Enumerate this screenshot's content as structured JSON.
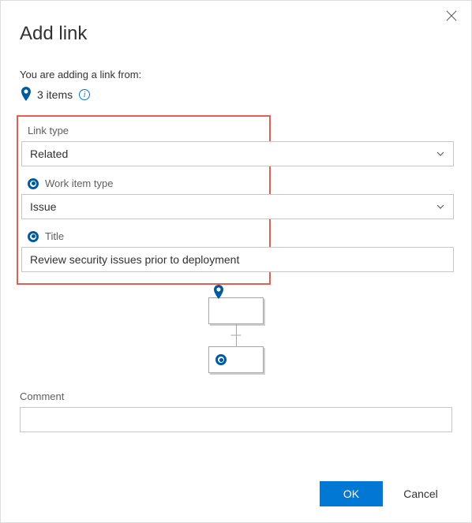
{
  "dialog": {
    "title": "Add link",
    "adding_from_label": "You are adding a link from:",
    "items_count_text": "3 items"
  },
  "fields": {
    "link_type": {
      "label": "Link type",
      "value": "Related"
    },
    "work_item_type": {
      "label": "Work item type",
      "value": "Issue"
    },
    "title": {
      "label": "Title",
      "value": "Review security issues prior to deployment"
    },
    "comment": {
      "label": "Comment",
      "value": ""
    }
  },
  "buttons": {
    "ok": "OK",
    "cancel": "Cancel"
  }
}
